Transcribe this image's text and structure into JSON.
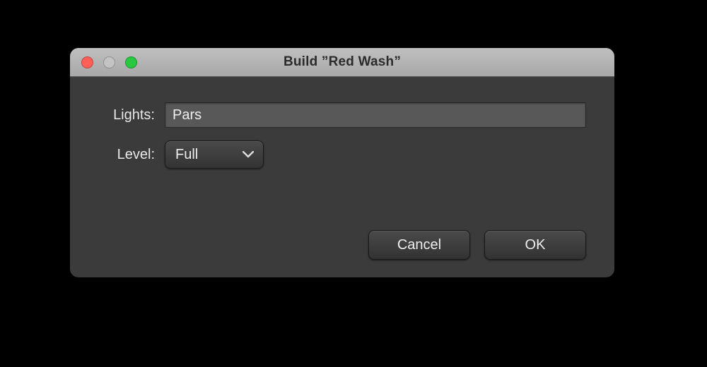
{
  "window": {
    "title": "Build ”Red Wash”"
  },
  "form": {
    "lights_label": "Lights:",
    "lights_value": "Pars",
    "level_label": "Level:",
    "level_value": "Full"
  },
  "buttons": {
    "cancel": "Cancel",
    "ok": "OK"
  }
}
